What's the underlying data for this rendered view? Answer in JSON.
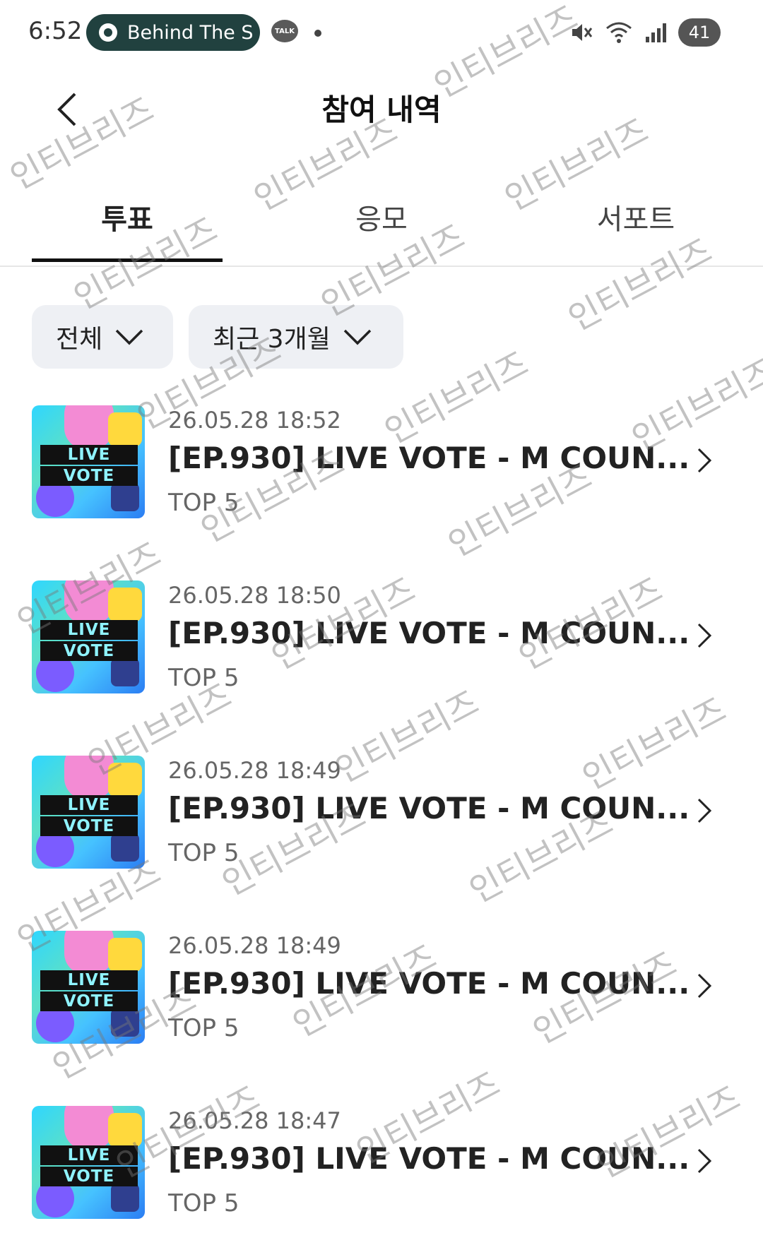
{
  "status_bar": {
    "time": "6:52",
    "media_pill": "Behind The S",
    "talk_badge": "TALK",
    "battery": "41"
  },
  "header": {
    "title": "참여 내역",
    "back_icon": "chevron-left-icon"
  },
  "tabs": [
    {
      "label": "투표",
      "active": true
    },
    {
      "label": "응모",
      "active": false
    },
    {
      "label": "서포트",
      "active": false
    }
  ],
  "filters": {
    "category": "전체",
    "period": "최근 3개월"
  },
  "list": [
    {
      "date": "26.05.28 18:52",
      "title": "[EP.930] LIVE VOTE - M COUN...",
      "sub": "TOP 5",
      "thumb_text_1": "LIVE",
      "thumb_text_2": "VOTE"
    },
    {
      "date": "26.05.28 18:50",
      "title": "[EP.930] LIVE VOTE - M COUN...",
      "sub": "TOP 5",
      "thumb_text_1": "LIVE",
      "thumb_text_2": "VOTE"
    },
    {
      "date": "26.05.28 18:49",
      "title": "[EP.930] LIVE VOTE - M COUN...",
      "sub": "TOP 5",
      "thumb_text_1": "LIVE",
      "thumb_text_2": "VOTE"
    },
    {
      "date": "26.05.28 18:49",
      "title": "[EP.930] LIVE VOTE - M COUN...",
      "sub": "TOP 5",
      "thumb_text_1": "LIVE",
      "thumb_text_2": "VOTE"
    },
    {
      "date": "26.05.28 18:47",
      "title": "[EP.930] LIVE VOTE - M COUN...",
      "sub": "TOP 5",
      "thumb_text_1": "LIVE",
      "thumb_text_2": "VOTE"
    }
  ],
  "watermark": "인티브리즈",
  "colors": {
    "pill_bg": "#21413f",
    "filter_bg": "#eef0f4",
    "tab_indicator": "#111111"
  }
}
